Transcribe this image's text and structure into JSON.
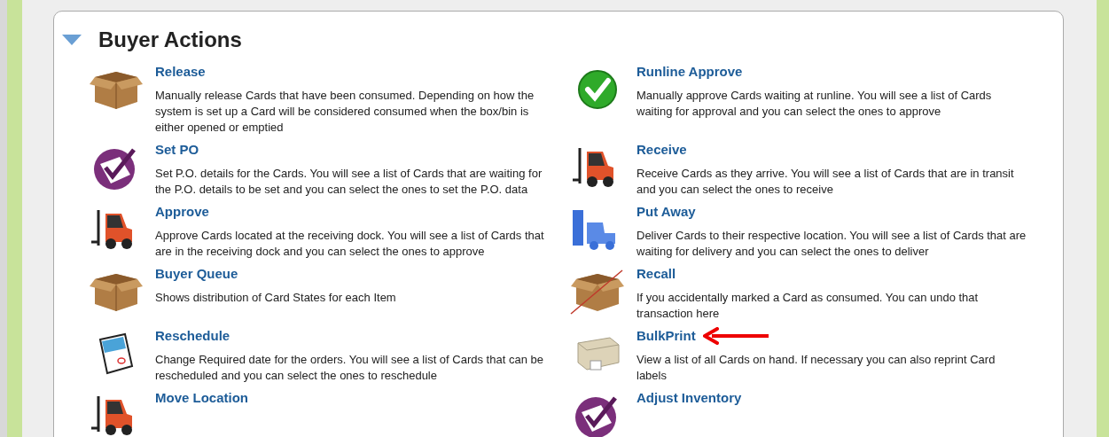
{
  "section": {
    "title": "Buyer Actions",
    "expanded": true
  },
  "rows": [
    {
      "left": {
        "kind": "box",
        "title": "Release",
        "description": "Manually release Cards that have been consumed. Depending on how the system is set up a Card will be considered consumed when the box/bin is either opened or emptied"
      },
      "right": {
        "kind": "check",
        "title": "Runline Approve",
        "description": "Manually approve Cards waiting at runline. You will see a list of Cards waiting for approval and you can select the ones to approve"
      }
    },
    {
      "left": {
        "kind": "clipboard",
        "title": "Set PO",
        "description": "Set P.O. details for the Cards. You will see a list of Cards that are waiting for the P.O. details to be set and you can select the ones to set the P.O. data"
      },
      "right": {
        "kind": "forklift",
        "title": "Receive",
        "description": "Receive Cards as they arrive. You will see a list of Cards that are in transit and you can select the ones to receive"
      }
    },
    {
      "left": {
        "kind": "forklift",
        "title": "Approve",
        "description": "Approve Cards located at the receiving dock. You will see a list of Cards that are in the receiving dock and you can select the ones to approve"
      },
      "right": {
        "kind": "putaway",
        "title": "Put Away",
        "description": "Deliver Cards to their respective location. You will see a list of Cards that are waiting for delivery and you can select the ones to deliver"
      }
    },
    {
      "left": {
        "kind": "box",
        "title": "Buyer Queue",
        "description": "Shows distribution of Card States for each Item"
      },
      "right": {
        "kind": "boxcrossed",
        "title": "Recall",
        "description": "If you accidentally marked a Card as consumed. You can undo that transaction here"
      }
    },
    {
      "left": {
        "kind": "calendar",
        "title": "Reschedule",
        "description": "Change Required date for the orders. You will see a list of Cards that can be rescheduled and you can select the ones to reschedule"
      },
      "right": {
        "kind": "printer",
        "title": "BulkPrint",
        "description": "View a list of all Cards on hand. If necessary you can also reprint Card labels",
        "pointer_arrow": true
      }
    },
    {
      "left": {
        "kind": "forklift",
        "title": "Move Location"
      },
      "right": {
        "kind": "clipboard",
        "title": "Adjust Inventory"
      }
    }
  ]
}
